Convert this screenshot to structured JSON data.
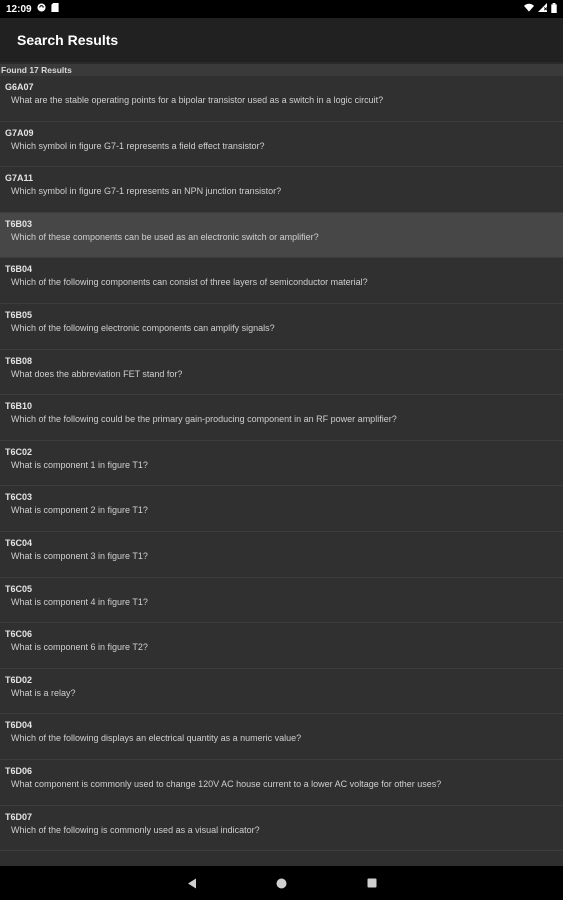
{
  "status_bar": {
    "time": "12:09"
  },
  "app_bar": {
    "title": "Search Results"
  },
  "results_header": "Found 17 Results",
  "results": [
    {
      "id": "G6A07",
      "text": "What are the stable operating points for a bipolar transistor used as a switch in a logic circuit?",
      "highlighted": false
    },
    {
      "id": "G7A09",
      "text": "Which symbol in figure G7-1 represents a field effect transistor?",
      "highlighted": false
    },
    {
      "id": "G7A11",
      "text": "Which symbol in figure G7-1 represents an NPN junction transistor?",
      "highlighted": false
    },
    {
      "id": "T6B03",
      "text": "Which of these components can be used as an electronic switch or amplifier?",
      "highlighted": true
    },
    {
      "id": "T6B04",
      "text": "Which of the following components can consist of three layers of semiconductor material?",
      "highlighted": false
    },
    {
      "id": "T6B05",
      "text": "Which of the following electronic components can amplify signals?",
      "highlighted": false
    },
    {
      "id": "T6B08",
      "text": "What does the abbreviation FET stand for?",
      "highlighted": false
    },
    {
      "id": "T6B10",
      "text": "Which of the following could be the primary gain-producing component in an RF power amplifier?",
      "highlighted": false
    },
    {
      "id": "T6C02",
      "text": "What is component 1 in figure T1?",
      "highlighted": false
    },
    {
      "id": "T6C03",
      "text": "What is component 2 in figure T1?",
      "highlighted": false
    },
    {
      "id": "T6C04",
      "text": "What is component 3 in figure T1?",
      "highlighted": false
    },
    {
      "id": "T6C05",
      "text": "What is component 4 in figure T1?",
      "highlighted": false
    },
    {
      "id": "T6C06",
      "text": "What is component 6 in figure T2?",
      "highlighted": false
    },
    {
      "id": "T6D02",
      "text": "What is a relay?",
      "highlighted": false
    },
    {
      "id": "T6D04",
      "text": "Which of the following displays an electrical quantity as a numeric value?",
      "highlighted": false
    },
    {
      "id": "T6D06",
      "text": "What component is commonly used to change 120V AC house current to a lower AC voltage for other uses?",
      "highlighted": false
    },
    {
      "id": "T6D07",
      "text": "Which of the following is commonly used as a visual indicator?",
      "highlighted": false
    }
  ],
  "nav_icons": [
    "back-icon",
    "home-icon",
    "recents-icon"
  ]
}
